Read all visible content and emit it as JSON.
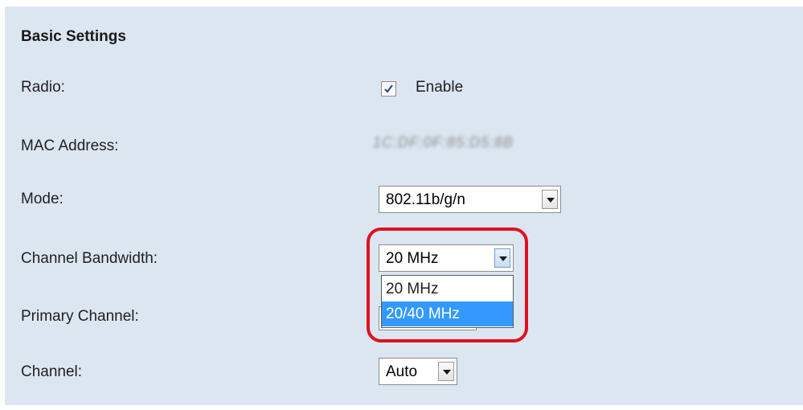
{
  "section": {
    "title": "Basic Settings"
  },
  "radio": {
    "label": "Radio:",
    "checkbox_label": "Enable",
    "checked": true
  },
  "mac": {
    "label": "MAC Address:",
    "value": "1C:DF:0F:85:D5:8B"
  },
  "mode": {
    "label": "Mode:",
    "selected": "802.11b/g/n"
  },
  "channel_bandwidth": {
    "label": "Channel Bandwidth:",
    "selected": "20 MHz",
    "options": [
      "20 MHz",
      "20/40 MHz"
    ],
    "highlighted_option": "20/40 MHz"
  },
  "primary_channel": {
    "label": "Primary Channel:"
  },
  "channel": {
    "label": "Channel:",
    "selected": "Auto"
  },
  "colors": {
    "panel_bg": "#dce6f1",
    "highlight_ring": "#e0101e",
    "option_selected": "#3399ff"
  },
  "icons": {
    "checkbox": "checkmark-icon",
    "dropdown": "chevron-down-icon"
  }
}
